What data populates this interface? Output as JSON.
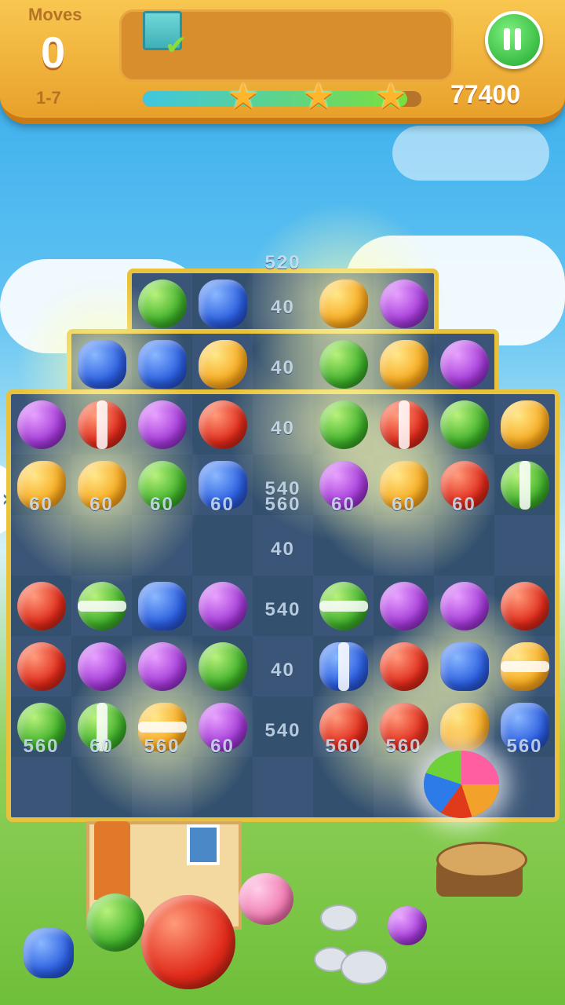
{
  "hud": {
    "moves_label": "Moves",
    "moves_value": "0",
    "level": "1-7",
    "score": "77400",
    "progress_fraction": 0.95,
    "stars_earned": 3
  },
  "goal": {
    "icon": "ice-block-icon",
    "status": "completed"
  },
  "board": {
    "score_popups": {
      "top": "520",
      "col5": [
        "40",
        "40",
        "40",
        "540",
        "40",
        "540",
        "40",
        "540"
      ],
      "row4": [
        "60",
        "60",
        "60",
        "60",
        "560",
        "60",
        "60",
        "60"
      ],
      "row8": [
        "560",
        "60",
        "560",
        "60",
        "560",
        "560",
        "560"
      ]
    }
  },
  "colors": {
    "topbar": "#f1b53e",
    "board_border": "#e8c23a",
    "cell": "#3a5577",
    "pause": "#1ea72e"
  }
}
